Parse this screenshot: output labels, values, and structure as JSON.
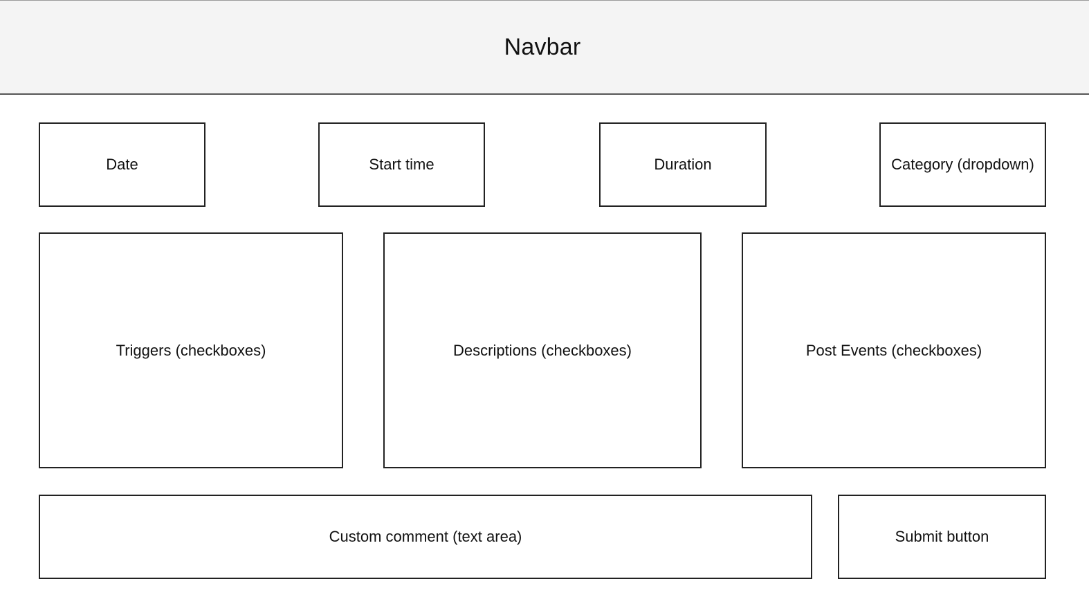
{
  "navbar": {
    "title": "Navbar"
  },
  "row1": {
    "date": "Date",
    "start_time": "Start time",
    "duration": "Duration",
    "category": "Category (dropdown)"
  },
  "row2": {
    "triggers": "Triggers (checkboxes)",
    "descriptions": "Descriptions (checkboxes)",
    "post_events": "Post Events (checkboxes)"
  },
  "row3": {
    "custom_comment": "Custom comment (text area)",
    "submit": "Submit button"
  }
}
